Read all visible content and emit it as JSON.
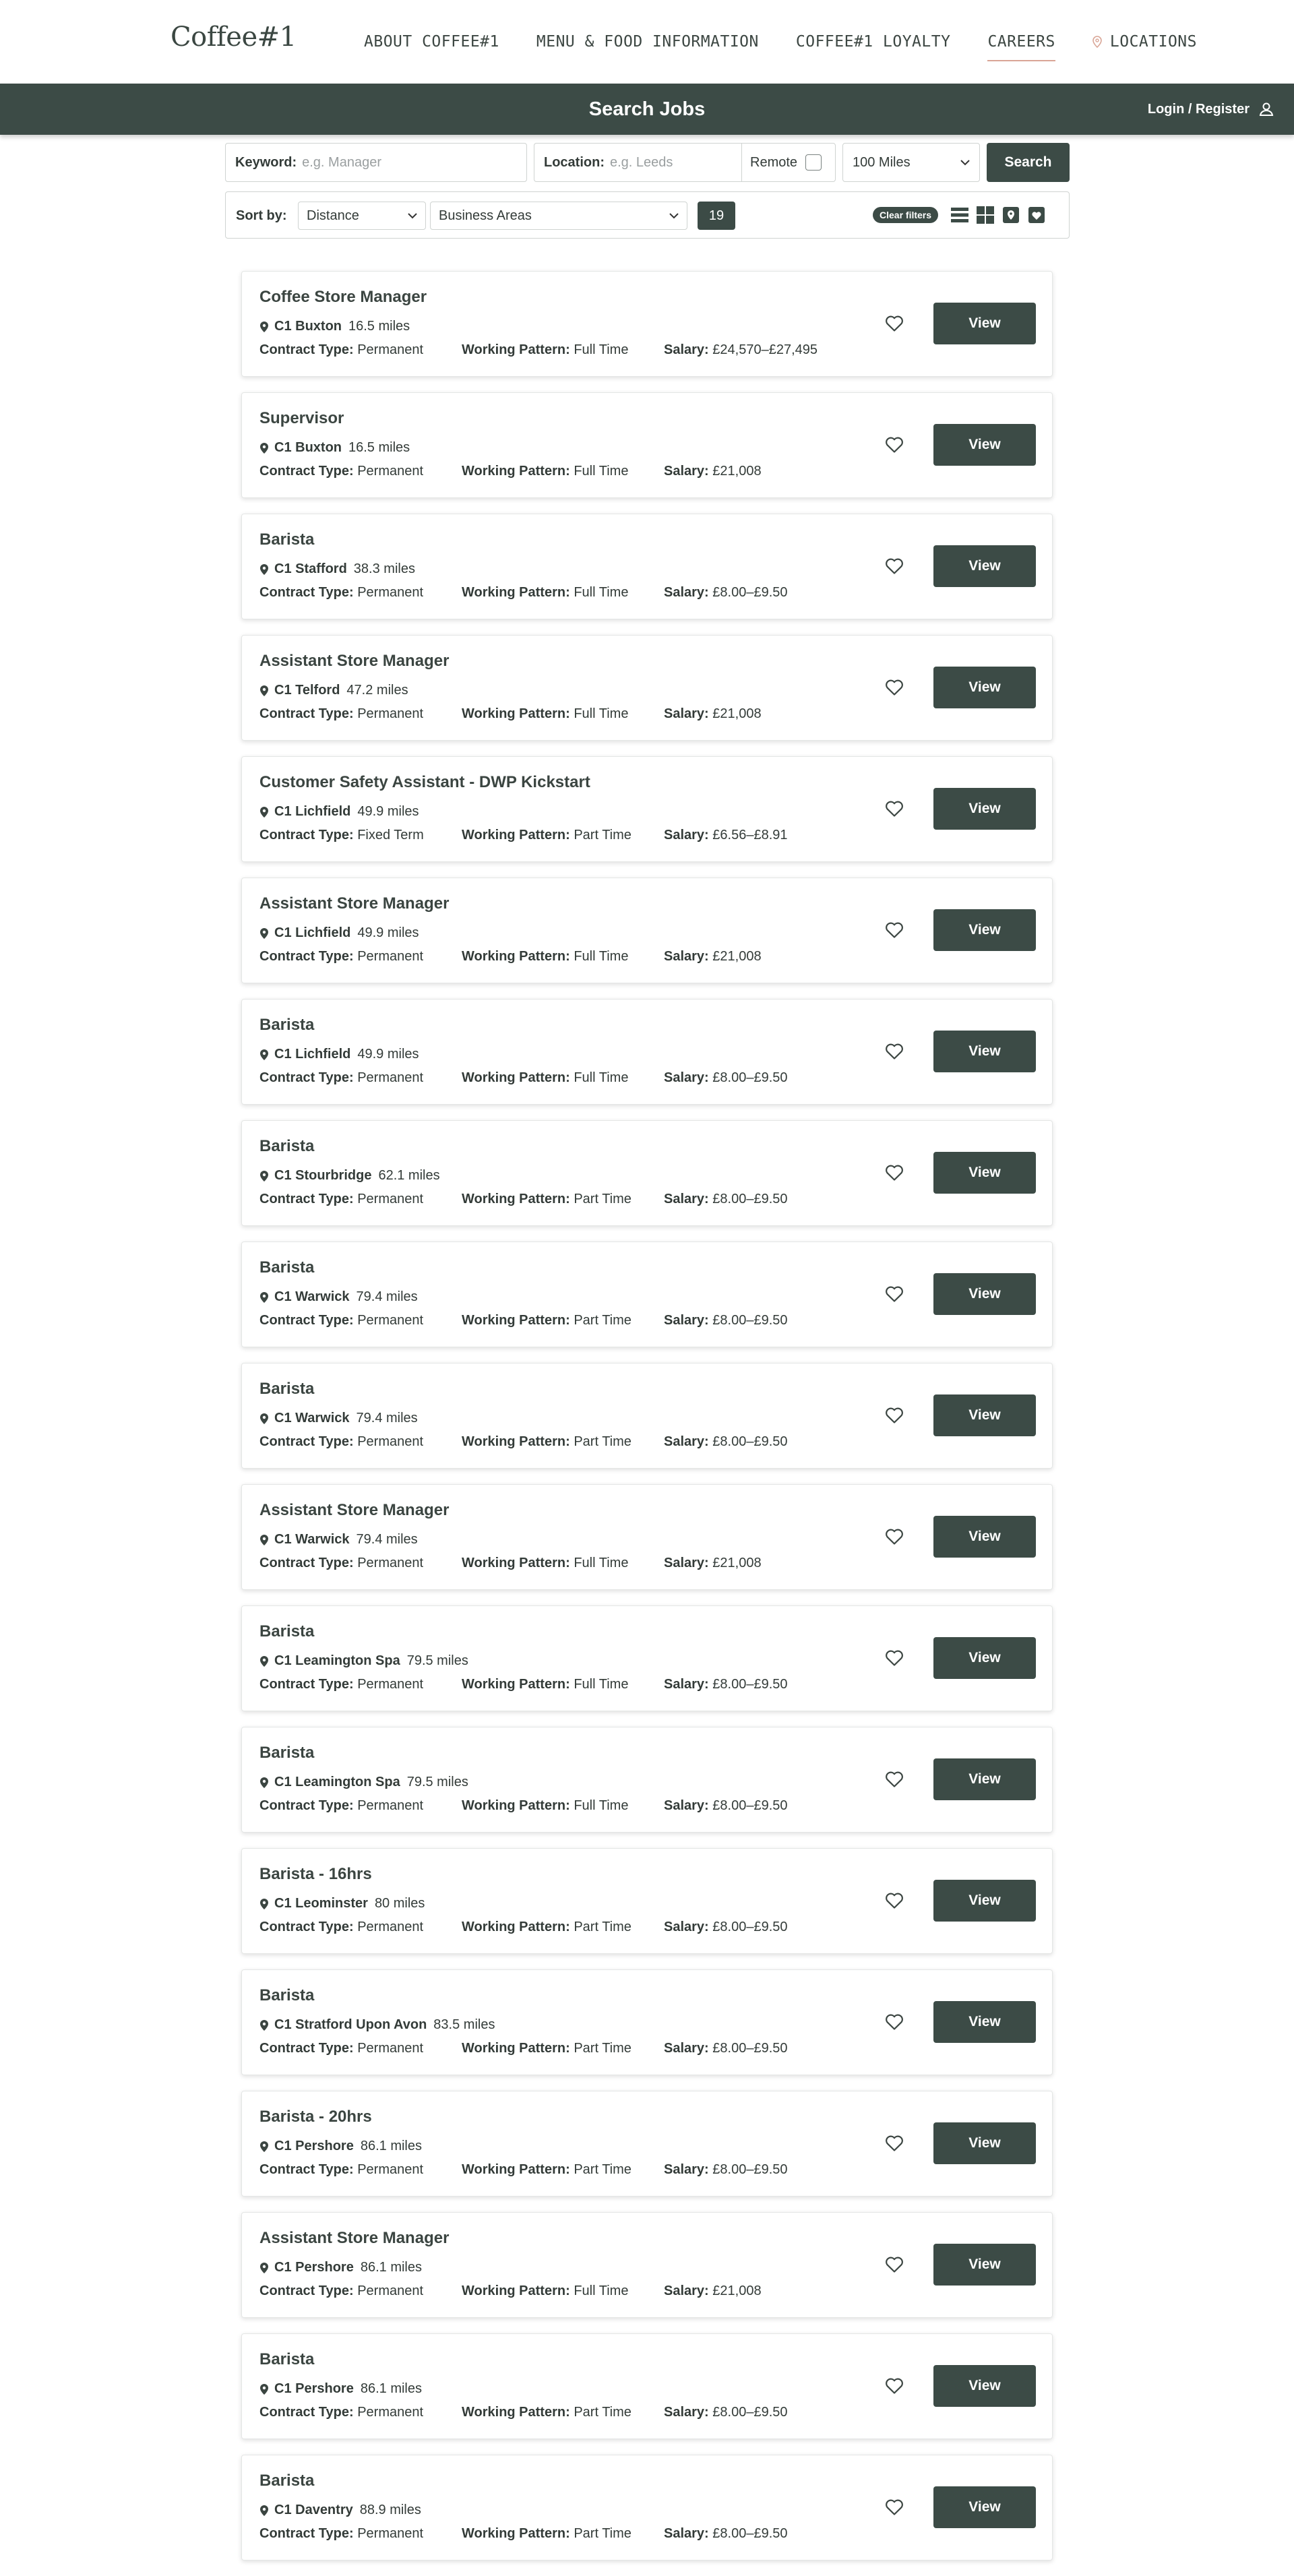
{
  "nav": {
    "logo": "Coffee#1",
    "items": [
      {
        "label": "ABOUT COFFEE#1"
      },
      {
        "label": "MENU & FOOD INFORMATION"
      },
      {
        "label": "COFFEE#1 LOYALTY"
      },
      {
        "label": "CAREERS"
      },
      {
        "label": "LOCATIONS"
      }
    ]
  },
  "header": {
    "title": "Search Jobs",
    "login_label": "Login / Register"
  },
  "search": {
    "keyword_label": "Keyword:",
    "keyword_placeholder": "e.g. Manager",
    "location_label": "Location:",
    "location_placeholder": "e.g. Leeds",
    "remote_label": "Remote",
    "distance_value": "100 Miles",
    "search_button": "Search"
  },
  "sort": {
    "label": "Sort by:",
    "sort_value": "Distance",
    "business_areas_value": "Business Areas",
    "count": "19",
    "clear_filters": "Clear filters"
  },
  "labels": {
    "contract": "Contract Type:",
    "pattern": "Working Pattern:",
    "salary": "Salary:",
    "view": "View"
  },
  "jobs": [
    {
      "title": "Coffee Store Manager",
      "store": "C1 Buxton",
      "distance": "16.5 miles",
      "contract": "Permanent",
      "pattern": "Full Time",
      "salary": "£24,570–£27,495"
    },
    {
      "title": "Supervisor",
      "store": "C1 Buxton",
      "distance": "16.5 miles",
      "contract": "Permanent",
      "pattern": "Full Time",
      "salary": "£21,008"
    },
    {
      "title": "Barista",
      "store": "C1 Stafford",
      "distance": "38.3 miles",
      "contract": "Permanent",
      "pattern": "Full Time",
      "salary": "£8.00–£9.50"
    },
    {
      "title": "Assistant Store Manager",
      "store": "C1 Telford",
      "distance": "47.2 miles",
      "contract": "Permanent",
      "pattern": "Full Time",
      "salary": "£21,008"
    },
    {
      "title": "Customer Safety Assistant - DWP Kickstart",
      "store": "C1 Lichfield",
      "distance": "49.9 miles",
      "contract": "Fixed Term",
      "pattern": "Part Time",
      "salary": "£6.56–£8.91"
    },
    {
      "title": "Assistant Store Manager",
      "store": "C1 Lichfield",
      "distance": "49.9 miles",
      "contract": "Permanent",
      "pattern": "Full Time",
      "salary": "£21,008"
    },
    {
      "title": "Barista",
      "store": "C1 Lichfield",
      "distance": "49.9 miles",
      "contract": "Permanent",
      "pattern": "Full Time",
      "salary": "£8.00–£9.50"
    },
    {
      "title": "Barista",
      "store": "C1 Stourbridge",
      "distance": "62.1 miles",
      "contract": "Permanent",
      "pattern": "Part Time",
      "salary": "£8.00–£9.50"
    },
    {
      "title": "Barista",
      "store": "C1 Warwick",
      "distance": "79.4 miles",
      "contract": "Permanent",
      "pattern": "Part Time",
      "salary": "£8.00–£9.50"
    },
    {
      "title": "Barista",
      "store": "C1 Warwick",
      "distance": "79.4 miles",
      "contract": "Permanent",
      "pattern": "Part Time",
      "salary": "£8.00–£9.50"
    },
    {
      "title": "Assistant Store Manager",
      "store": "C1 Warwick",
      "distance": "79.4 miles",
      "contract": "Permanent",
      "pattern": "Full Time",
      "salary": "£21,008"
    },
    {
      "title": "Barista",
      "store": "C1 Leamington Spa",
      "distance": "79.5 miles",
      "contract": "Permanent",
      "pattern": "Full Time",
      "salary": "£8.00–£9.50"
    },
    {
      "title": "Barista",
      "store": "C1 Leamington Spa",
      "distance": "79.5 miles",
      "contract": "Permanent",
      "pattern": "Full Time",
      "salary": "£8.00–£9.50"
    },
    {
      "title": "Barista - 16hrs",
      "store": "C1 Leominster",
      "distance": "80 miles",
      "contract": "Permanent",
      "pattern": "Part Time",
      "salary": "£8.00–£9.50"
    },
    {
      "title": "Barista",
      "store": "C1 Stratford Upon Avon",
      "distance": "83.5 miles",
      "contract": "Permanent",
      "pattern": "Part Time",
      "salary": "£8.00–£9.50"
    },
    {
      "title": "Barista - 20hrs",
      "store": "C1 Pershore",
      "distance": "86.1 miles",
      "contract": "Permanent",
      "pattern": "Part Time",
      "salary": "£8.00–£9.50"
    },
    {
      "title": "Assistant Store Manager",
      "store": "C1 Pershore",
      "distance": "86.1 miles",
      "contract": "Permanent",
      "pattern": "Full Time",
      "salary": "£21,008"
    },
    {
      "title": "Barista",
      "store": "C1 Pershore",
      "distance": "86.1 miles",
      "contract": "Permanent",
      "pattern": "Part Time",
      "salary": "£8.00–£9.50"
    },
    {
      "title": "Barista",
      "store": "C1 Daventry",
      "distance": "88.9 miles",
      "contract": "Permanent",
      "pattern": "Part Time",
      "salary": "£8.00–£9.50"
    }
  ]
}
